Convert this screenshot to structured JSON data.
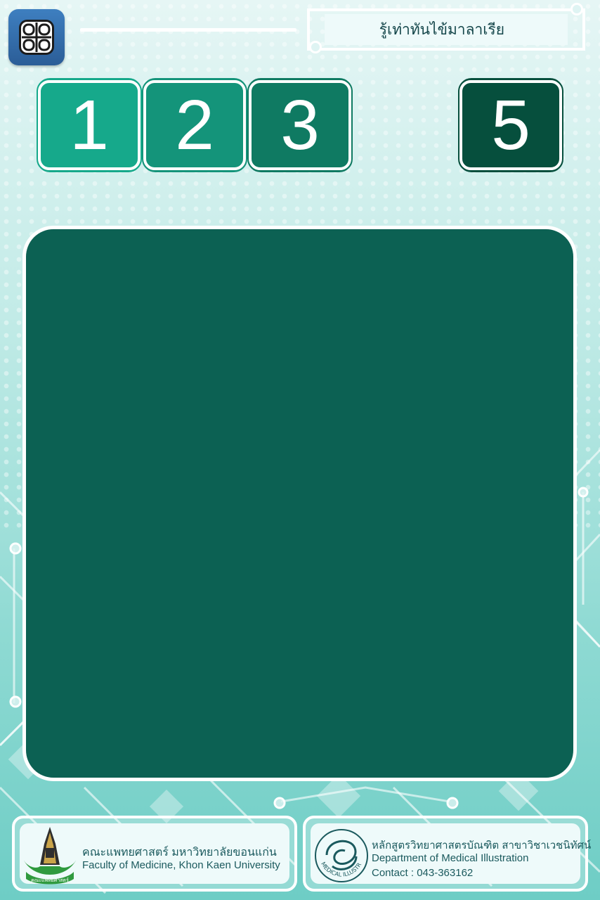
{
  "header": {
    "menu_icon": "grid-menu-icon",
    "title": "รู้เท่าทันไข้มาลาเรีย"
  },
  "level_buttons": [
    {
      "label": "1",
      "color": "#16a98b"
    },
    {
      "label": "2",
      "color": "#14947a"
    },
    {
      "label": "3",
      "color": "#0f7a62"
    },
    {
      "label": "5",
      "color": "#064f3d"
    }
  ],
  "content_panel": {
    "color": "#0c6153"
  },
  "footer": {
    "left": {
      "logo_icon": "khon-kaen-university-logo-icon",
      "logo_text": "คณะแพทยศาสตร์",
      "line1": "คณะแพทยศาสตร์ มหาวิทยาลัยขอนแก่น",
      "line2": "Faculty of Medicine, Khon Kaen University"
    },
    "right": {
      "logo_icon": "medical-illustration-logo-icon",
      "logo_text": "MEDICAL ILLUSTRATION",
      "line1": "หลักสูตรวิทยาศาสตรบัณฑิต สาขาวิชาเวชนิทัศน์",
      "line2": "Department of Medical Illustration",
      "line3": "Contact : 043-363162"
    }
  }
}
